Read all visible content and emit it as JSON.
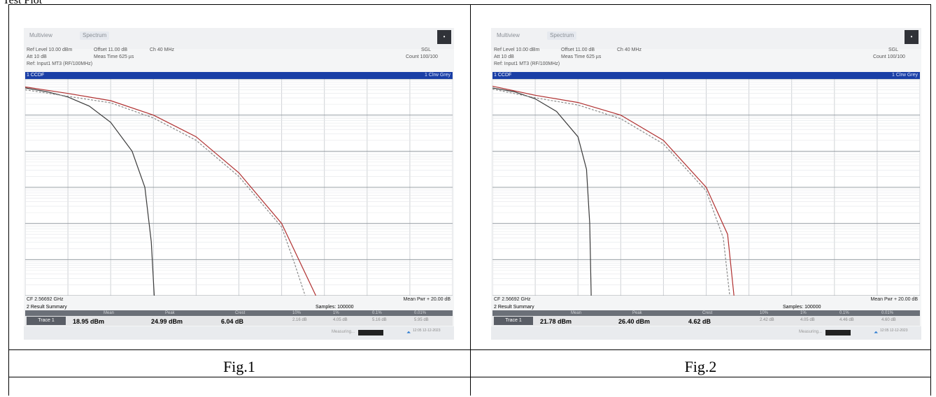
{
  "page": {
    "top_cut_text": "Test Plot",
    "captions": [
      "Fig.1",
      "Fig.2"
    ]
  },
  "colors": {
    "title_bar": "#1a3fa6",
    "grid": "#cfd2d6",
    "trace_black": "#3b3b3b",
    "trace_red": "#b03030",
    "trace_dashed": "#8a8a8a"
  },
  "panels": [
    {
      "tabs": [
        "Multiview",
        "Spectrum"
      ],
      "ref_level": "Ref Level 10.00 dBm",
      "att": "Att 10 dB",
      "offset": "Offset 11.00 dB",
      "meas_time": "Meas Time 625 µs",
      "mode": "Ch 40 MHz",
      "trace_label": "Ref: Input1 MT3 (RF/100MHz)",
      "right_top": "SGL",
      "right_sub": "Count 100/100",
      "plot_title": "1 CCDF",
      "plot_title_right": "1 Clrw Grey",
      "footer_left": "CF 2.56692 GHz",
      "footer_right": "Mean Pwr + 20.00 dB",
      "summary_title": "2 Result Summary",
      "samples": "Samples: 100000",
      "headers": [
        "Mean",
        "Peak",
        "Crest",
        "10%",
        "1%",
        "0.1%",
        "0.01%"
      ],
      "trace_name": "Trace 1",
      "mean": "18.95 dBm",
      "peak": "24.99 dBm",
      "crest": "6.04 dB",
      "pct10": "2.16 dB",
      "pct1": "4.05 dB",
      "pct01": "5.16 dB",
      "pct001": "5.95 dB",
      "status_meas": "Measuring...",
      "status_time": "12:05 12-12-2023"
    },
    {
      "tabs": [
        "Multiview",
        "Spectrum"
      ],
      "ref_level": "Ref Level 10.00 dBm",
      "att": "Att 10 dB",
      "offset": "Offset 11.00 dB",
      "meas_time": "Meas Time 625 µs",
      "mode": "Ch 40 MHz",
      "trace_label": "Ref: Input1 MT3 (RF/100MHz)",
      "right_top": "SGL",
      "right_sub": "Count 100/100",
      "plot_title": "1 CCDF",
      "plot_title_right": "1 Clrw Grey",
      "footer_left": "CF 2.56692 GHz",
      "footer_right": "Mean Pwr + 20.00 dB",
      "summary_title": "2 Result Summary",
      "samples": "Samples: 100000",
      "headers": [
        "Mean",
        "Peak",
        "Crest",
        "10%",
        "1%",
        "0.1%",
        "0.01%"
      ],
      "trace_name": "Trace 1",
      "mean": "21.78 dBm",
      "peak": "26.40 dBm",
      "crest": "4.62 dB",
      "pct10": "2.42 dB",
      "pct1": "4.05 dB",
      "pct01": "4.46 dB",
      "pct001": "4.60 dB",
      "status_meas": "Measuring...",
      "status_time": "12:05 12-12-2023"
    }
  ],
  "chart_data": [
    {
      "type": "line",
      "title": "",
      "xlabel": "",
      "ylabel": "",
      "xlim": [
        0,
        20
      ],
      "ylim": [
        -6,
        0
      ],
      "series": [
        {
          "x": [
            0,
            1,
            2,
            3,
            4,
            5,
            5.6,
            5.9,
            6.04
          ],
          "y": [
            -0.25,
            -0.35,
            -0.5,
            -0.75,
            -1.2,
            -2.0,
            -3.0,
            -4.5,
            -6
          ]
        },
        {
          "x": [
            0,
            2,
            4,
            6,
            8,
            10,
            12,
            12.8,
            13.6
          ],
          "y": [
            -0.22,
            -0.4,
            -0.6,
            -1.0,
            -1.6,
            -2.6,
            -4.0,
            -5.0,
            -6
          ]
        },
        {
          "x": [
            0,
            2,
            4,
            6,
            8,
            10,
            12,
            12.6,
            13.1
          ],
          "y": [
            -0.3,
            -0.48,
            -0.66,
            -1.08,
            -1.7,
            -2.7,
            -4.1,
            -5.1,
            -6
          ]
        }
      ]
    },
    {
      "type": "line",
      "title": "",
      "xlabel": "",
      "ylabel": "",
      "xlim": [
        0,
        20
      ],
      "ylim": [
        -6,
        0
      ],
      "series": [
        {
          "x": [
            0,
            1,
            2,
            3,
            4,
            4.4,
            4.55,
            4.62
          ],
          "y": [
            -0.25,
            -0.35,
            -0.55,
            -0.9,
            -1.6,
            -2.5,
            -4.0,
            -6
          ]
        },
        {
          "x": [
            0,
            2,
            4,
            6,
            8,
            10,
            11,
            11.3
          ],
          "y": [
            -0.2,
            -0.45,
            -0.65,
            -1.0,
            -1.7,
            -3.0,
            -4.3,
            -6
          ]
        },
        {
          "x": [
            0,
            2,
            4,
            6,
            8,
            10,
            10.8,
            11.1
          ],
          "y": [
            -0.28,
            -0.52,
            -0.72,
            -1.1,
            -1.8,
            -3.1,
            -4.4,
            -6
          ]
        }
      ]
    }
  ]
}
